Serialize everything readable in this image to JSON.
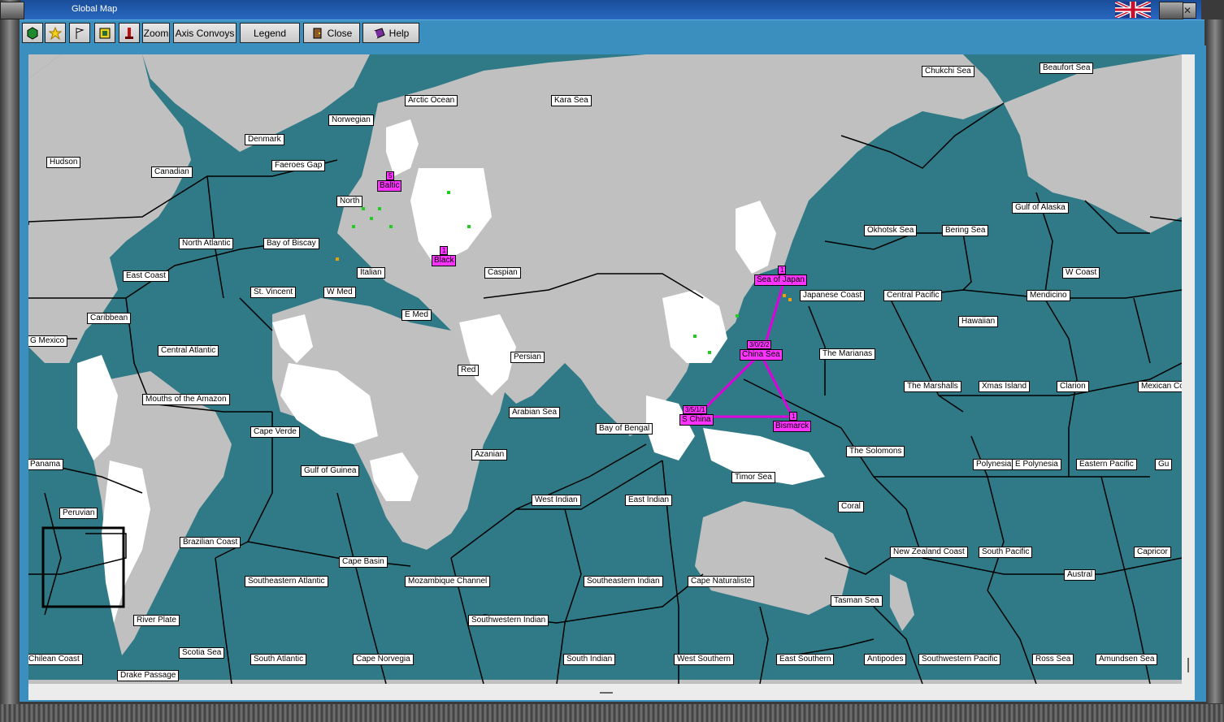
{
  "window": {
    "title": "Global Map",
    "close_glyph": "✕"
  },
  "toolbar": {
    "zoom": "Zoom",
    "axis_convoys": "Axis Convoys",
    "legend": "Legend",
    "close": "Close",
    "help": "Help",
    "icons": [
      "hexagon-icon",
      "burst-icon",
      "flag-icon",
      "target-icon",
      "pillar-icon"
    ]
  },
  "colors": {
    "sea": "#2f7a86",
    "land": "#c0c0c0",
    "neutral": "#ffffff",
    "task_force": "#ff33ff",
    "toolbar": "#3a8fbe"
  },
  "sea_zones": [
    {
      "id": "chukchi",
      "text": "Chukchi Sea"
    },
    {
      "id": "beaufort",
      "text": "Beaufort Sea"
    },
    {
      "id": "arctic",
      "text": "Arctic Ocean"
    },
    {
      "id": "kara",
      "text": "Kara Sea"
    },
    {
      "id": "norwegian",
      "text": "Norwegian"
    },
    {
      "id": "denmark",
      "text": "Denmark"
    },
    {
      "id": "hudson",
      "text": "Hudson"
    },
    {
      "id": "canadian",
      "text": "Canadian"
    },
    {
      "id": "faeroes",
      "text": "Faeroes Gap"
    },
    {
      "id": "north",
      "text": "North"
    },
    {
      "id": "gulf_alaska",
      "text": "Gulf of Alaska"
    },
    {
      "id": "okhotsk",
      "text": "Okhotsk Sea"
    },
    {
      "id": "bering",
      "text": "Bering Sea"
    },
    {
      "id": "north_atlantic",
      "text": "North Atlantic"
    },
    {
      "id": "biscay",
      "text": "Bay of Biscay"
    },
    {
      "id": "caspian",
      "text": "Caspian"
    },
    {
      "id": "w_coast",
      "text": "W Coast"
    },
    {
      "id": "east_coast",
      "text": "East Coast"
    },
    {
      "id": "italian",
      "text": "Italian"
    },
    {
      "id": "st_vincent",
      "text": "St. Vincent"
    },
    {
      "id": "w_med",
      "text": "W Med"
    },
    {
      "id": "japanese_coast",
      "text": "Japanese Coast"
    },
    {
      "id": "central_pacific",
      "text": "Central Pacific"
    },
    {
      "id": "mendicino",
      "text": "Mendicino"
    },
    {
      "id": "caribbean",
      "text": "Caribbean"
    },
    {
      "id": "e_med",
      "text": "E Med"
    },
    {
      "id": "hawaiian",
      "text": "Hawaiian"
    },
    {
      "id": "g_mexico",
      "text": "G Mexico"
    },
    {
      "id": "central_atlantic",
      "text": "Central Atlantic"
    },
    {
      "id": "marianas",
      "text": "The Marianas"
    },
    {
      "id": "persian",
      "text": "Persian"
    },
    {
      "id": "red",
      "text": "Red"
    },
    {
      "id": "marshalls",
      "text": "The Marshalls"
    },
    {
      "id": "xmas",
      "text": "Xmas Island"
    },
    {
      "id": "clarion",
      "text": "Clarion"
    },
    {
      "id": "mexican_coast",
      "text": "Mexican Coa"
    },
    {
      "id": "amazon",
      "text": "Mouths of the Amazon"
    },
    {
      "id": "arabian",
      "text": "Arabian Sea"
    },
    {
      "id": "cape_verde",
      "text": "Cape Verde"
    },
    {
      "id": "bengal",
      "text": "Bay of Bengal"
    },
    {
      "id": "azanian",
      "text": "Azanian"
    },
    {
      "id": "solomons",
      "text": "The Solomons"
    },
    {
      "id": "panama",
      "text": "Panama"
    },
    {
      "id": "guinea",
      "text": "Gulf of Guinea"
    },
    {
      "id": "polynesia",
      "text": "Polynesia"
    },
    {
      "id": "e_polynesia",
      "text": "E Polynesia"
    },
    {
      "id": "eastern_pacific",
      "text": "Eastern Pacific"
    },
    {
      "id": "gu",
      "text": "Gu"
    },
    {
      "id": "timor",
      "text": "Timor Sea"
    },
    {
      "id": "west_indian",
      "text": "West Indian"
    },
    {
      "id": "east_indian",
      "text": "East Indian"
    },
    {
      "id": "peruvian",
      "text": "Peruvian"
    },
    {
      "id": "coral",
      "text": "Coral"
    },
    {
      "id": "brazilian",
      "text": "Brazilian Coast"
    },
    {
      "id": "nz_coast",
      "text": "New Zealand Coast"
    },
    {
      "id": "south_pacific",
      "text": "South Pacific"
    },
    {
      "id": "capricorn",
      "text": "Capricor"
    },
    {
      "id": "cape_basin",
      "text": "Cape Basin"
    },
    {
      "id": "austral",
      "text": "Austral"
    },
    {
      "id": "se_atlantic",
      "text": "Southeastern Atlantic"
    },
    {
      "id": "mozambique",
      "text": "Mozambique Channel"
    },
    {
      "id": "se_indian",
      "text": "Southeastern Indian"
    },
    {
      "id": "cape_naturaliste",
      "text": "Cape Naturaliste"
    },
    {
      "id": "tasman",
      "text": "Tasman Sea"
    },
    {
      "id": "river_plate",
      "text": "River Plate"
    },
    {
      "id": "sw_indian",
      "text": "Southwestern Indian"
    },
    {
      "id": "scotia",
      "text": "Scotia Sea"
    },
    {
      "id": "chilean",
      "text": "Chilean Coast"
    },
    {
      "id": "south_atlantic",
      "text": "South Atlantic"
    },
    {
      "id": "cape_norvegia",
      "text": "Cape Norvegia"
    },
    {
      "id": "south_indian",
      "text": "South Indian"
    },
    {
      "id": "west_southern",
      "text": "West Southern"
    },
    {
      "id": "east_southern",
      "text": "East Southern"
    },
    {
      "id": "antipodes",
      "text": "Antipodes"
    },
    {
      "id": "sw_pacific",
      "text": "Southwestern Pacific"
    },
    {
      "id": "ross",
      "text": "Ross Sea"
    },
    {
      "id": "amundsen",
      "text": "Amundsen Sea"
    },
    {
      "id": "drake",
      "text": "Drake Passage"
    }
  ],
  "task_forces": [
    {
      "id": "baltic",
      "name": "Baltic",
      "count": "5"
    },
    {
      "id": "black",
      "name": "Black",
      "count": "1"
    },
    {
      "id": "japan",
      "name": "Sea of Japan",
      "count": "1"
    },
    {
      "id": "china",
      "name": "China Sea",
      "count": "3/0/2/2"
    },
    {
      "id": "schina",
      "name": "S China",
      "count": "3/5/1/1"
    },
    {
      "id": "bismarck",
      "name": "Bismarck",
      "count": "1"
    }
  ]
}
